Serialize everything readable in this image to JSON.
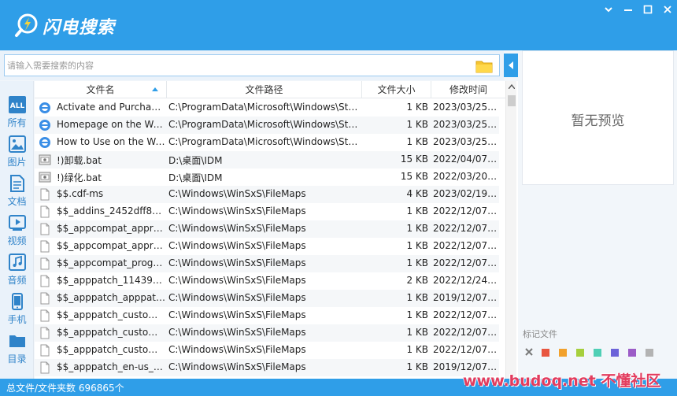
{
  "app": {
    "title": "闪电搜索",
    "colors": {
      "primary": "#2f9ee8",
      "sidebar_label": "#2f83c9"
    }
  },
  "window_controls": [
    "chevron-down-icon",
    "minimize-icon",
    "maximize-icon",
    "close-icon"
  ],
  "search": {
    "placeholder": "请输入需要搜索的内容",
    "value": ""
  },
  "sidebar": {
    "items": [
      {
        "label": "所有",
        "icon": "all-icon",
        "selected": true
      },
      {
        "label": "图片",
        "icon": "image-icon"
      },
      {
        "label": "文档",
        "icon": "document-icon"
      },
      {
        "label": "视频",
        "icon": "video-icon"
      },
      {
        "label": "音频",
        "icon": "audio-icon"
      },
      {
        "label": "手机",
        "icon": "phone-icon"
      },
      {
        "label": "目录",
        "icon": "folder-icon"
      }
    ]
  },
  "table": {
    "columns": [
      "文件名",
      "文件路径",
      "文件大小",
      "修改时间"
    ],
    "sorted_column": "文件名",
    "rows": [
      {
        "icon": "ie-icon",
        "name": "Activate and Purchase ...",
        "path": "C:\\ProgramData\\Microsoft\\Windows\\Star...",
        "size": "1 KB",
        "date": "2023/03/25 1..."
      },
      {
        "icon": "ie-icon",
        "name": "Homepage on the We...",
        "path": "C:\\ProgramData\\Microsoft\\Windows\\Star...",
        "size": "1 KB",
        "date": "2023/03/25 1..."
      },
      {
        "icon": "ie-icon",
        "name": "How to Use on the We...",
        "path": "C:\\ProgramData\\Microsoft\\Windows\\Star...",
        "size": "1 KB",
        "date": "2023/03/25 1..."
      },
      {
        "icon": "bat-icon",
        "name": "!)卸载.bat",
        "path": "D:\\桌面\\IDM",
        "size": "15 KB",
        "date": "2022/04/07 1..."
      },
      {
        "icon": "bat-icon",
        "name": "!)绿化.bat",
        "path": "D:\\桌面\\IDM",
        "size": "15 KB",
        "date": "2022/03/20 1..."
      },
      {
        "icon": "file-icon",
        "name": "$$.cdf-ms",
        "path": "C:\\Windows\\WinSxS\\FileMaps",
        "size": "4 KB",
        "date": "2023/02/19 2..."
      },
      {
        "icon": "file-icon",
        "name": "$$_addins_2452dff8cb6...",
        "path": "C:\\Windows\\WinSxS\\FileMaps",
        "size": "1 KB",
        "date": "2022/12/07 1..."
      },
      {
        "icon": "file-icon",
        "name": "$$_appcompat_apprais...",
        "path": "C:\\Windows\\WinSxS\\FileMaps",
        "size": "1 KB",
        "date": "2022/12/07 1..."
      },
      {
        "icon": "file-icon",
        "name": "$$_appcompat_apprais...",
        "path": "C:\\Windows\\WinSxS\\FileMaps",
        "size": "1 KB",
        "date": "2022/12/07 1..."
      },
      {
        "icon": "file-icon",
        "name": "$$_appcompat_progra...",
        "path": "C:\\Windows\\WinSxS\\FileMaps",
        "size": "1 KB",
        "date": "2022/12/07 1..."
      },
      {
        "icon": "file-icon",
        "name": "$$_apppatch_1143992c...",
        "path": "C:\\Windows\\WinSxS\\FileMaps",
        "size": "2 KB",
        "date": "2022/12/24 1..."
      },
      {
        "icon": "file-icon",
        "name": "$$_apppatch_apppatch...",
        "path": "C:\\Windows\\WinSxS\\FileMaps",
        "size": "1 KB",
        "date": "2019/12/07 1..."
      },
      {
        "icon": "file-icon",
        "name": "$$_apppatch_custom_2...",
        "path": "C:\\Windows\\WinSxS\\FileMaps",
        "size": "1 KB",
        "date": "2022/12/07 1..."
      },
      {
        "icon": "file-icon",
        "name": "$$_apppatch_custom_c...",
        "path": "C:\\Windows\\WinSxS\\FileMaps",
        "size": "1 KB",
        "date": "2022/12/07 1..."
      },
      {
        "icon": "file-icon",
        "name": "$$_apppatch_customsd...",
        "path": "C:\\Windows\\WinSxS\\FileMaps",
        "size": "1 KB",
        "date": "2022/12/07 1..."
      },
      {
        "icon": "file-icon",
        "name": "$$_apppatch_en-us_098...",
        "path": "C:\\Windows\\WinSxS\\FileMaps",
        "size": "1 KB",
        "date": "2019/12/07 1..."
      }
    ]
  },
  "preview": {
    "empty_text": "暂无预览"
  },
  "tags": {
    "label": "标记文件",
    "colors": [
      "#e8553f",
      "#f2a12c",
      "#a6cf3d",
      "#4fcfb5",
      "#6c63d9",
      "#9c5cc7",
      "#b3b3b3"
    ]
  },
  "status": {
    "text": "总文件/文件夹数 696865个"
  },
  "watermark": {
    "text": "www.budoq.net 不懂社区"
  }
}
